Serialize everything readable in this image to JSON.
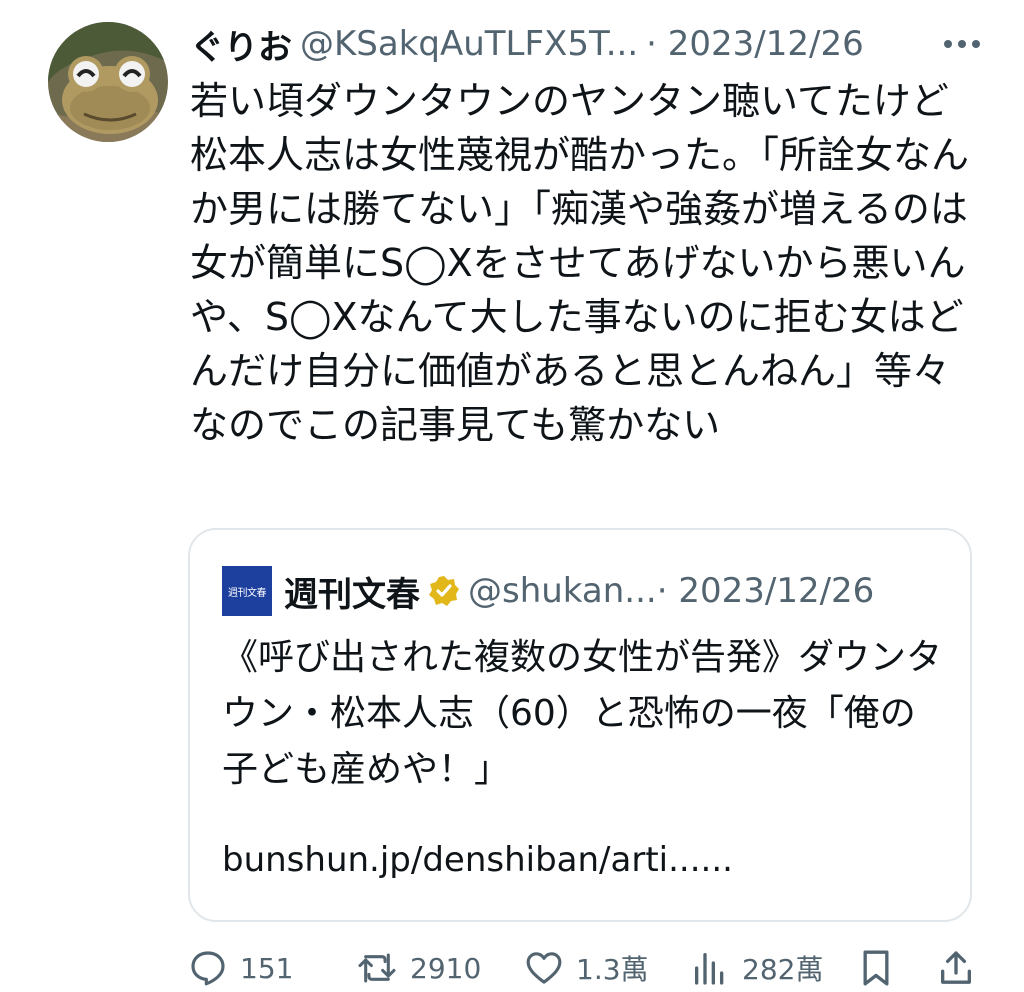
{
  "tweet": {
    "display_name": "ぐりお",
    "handle": "@KSakqAuTLFX5T...",
    "date": "· 2023/12/26",
    "text": "若い頃ダウンタウンのヤンタン聴いてたけど松本人志は女性蔑視が酷かった。「所詮女なんか男には勝てない」「痴漢や強姦が増えるのは女が簡単にS◯Xをさせてあげないから悪いんや、S◯Xなんて大した事ないのに拒む女はどんだけ自分に価値があると思とんねん」等々\nなのでこの記事見ても驚かない",
    "avatar_icon": "frog-figurine-avatar"
  },
  "quote": {
    "logo_text": "週刊文春",
    "display_name": "週刊文春",
    "handle": "@shukan...",
    "date": "· 2023/12/26",
    "text": "《呼び出された複数の女性が告発》ダウンタウン・松本人志（60）と恐怖の一夜「俺の子ども産めや！」",
    "link": "bunshun.jp/denshiban/arti......"
  },
  "actions": {
    "replies": "151",
    "retweets": "2910",
    "likes": "1.3萬",
    "views": "282萬"
  },
  "colors": {
    "text": "#0f1419",
    "secondary": "#536471",
    "border": "#e1e6ea",
    "verified_gold": "#e2b719"
  }
}
